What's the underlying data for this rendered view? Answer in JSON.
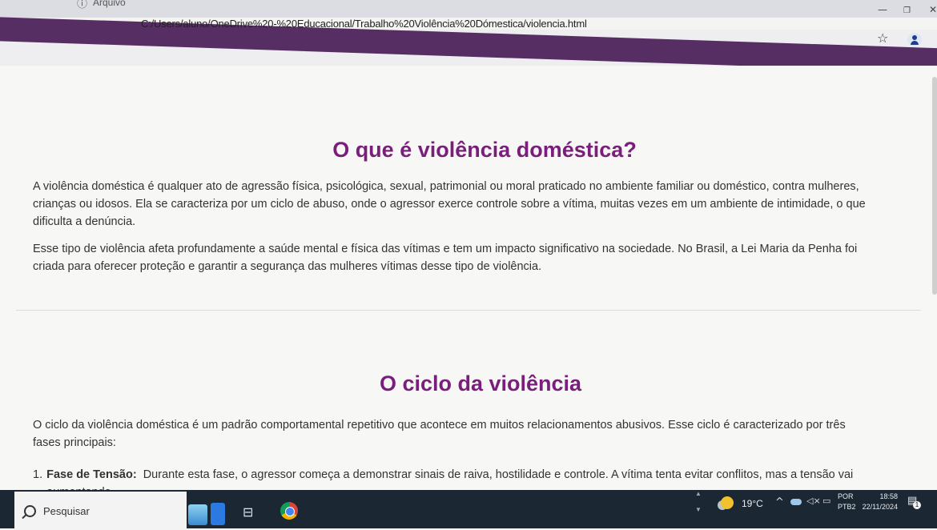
{
  "browser": {
    "file_label": "Arquivo",
    "url": "C:/Users/aluno/OneDrive%20-%20Educacional/Trabalho%20Violência%20Dómestica/violencia.html"
  },
  "section1": {
    "title": "O que é violência doméstica?",
    "paragraph1": "A violência doméstica é qualquer ato de agressão física, psicológica, sexual, patrimonial ou moral praticado no ambiente familiar ou doméstico, contra mulheres, crianças ou idosos. Ela se caracteriza por um ciclo de abuso, onde o agressor exerce controle sobre a vítima, muitas vezes em um ambiente de intimidade, o que dificulta a denúncia.",
    "paragraph2": "Esse tipo de violência afeta profundamente a saúde mental e física das vítimas e tem um impacto significativo na sociedade. No Brasil, a Lei Maria da Penha foi criada para oferecer proteção e garantir a segurança das mulheres vítimas desse tipo de violência."
  },
  "section2": {
    "title": "O ciclo da violência",
    "intro": "O ciclo da violência doméstica é um padrão comportamental repetitivo que acontece em muitos relacionamentos abusivos. Esse ciclo é caracterizado por três fases principais:",
    "phases": [
      {
        "number": "1.",
        "title": "Fase de Tensão:",
        "text": "Durante esta fase, o agressor começa a demonstrar sinais de raiva, hostilidade e controle. A vítima tenta evitar conflitos, mas a tensão vai aumentando."
      }
    ]
  },
  "taskbar": {
    "search_placeholder": "Pesquisar",
    "temperature": "19°C",
    "language": "POR",
    "keyboard": "PTB2",
    "time": "18:58",
    "date": "22/11/2024",
    "notification_count": "1"
  },
  "colors": {
    "heading": "#7a1e7c",
    "header_band": "#562e63",
    "taskbar": "#1b2733"
  }
}
